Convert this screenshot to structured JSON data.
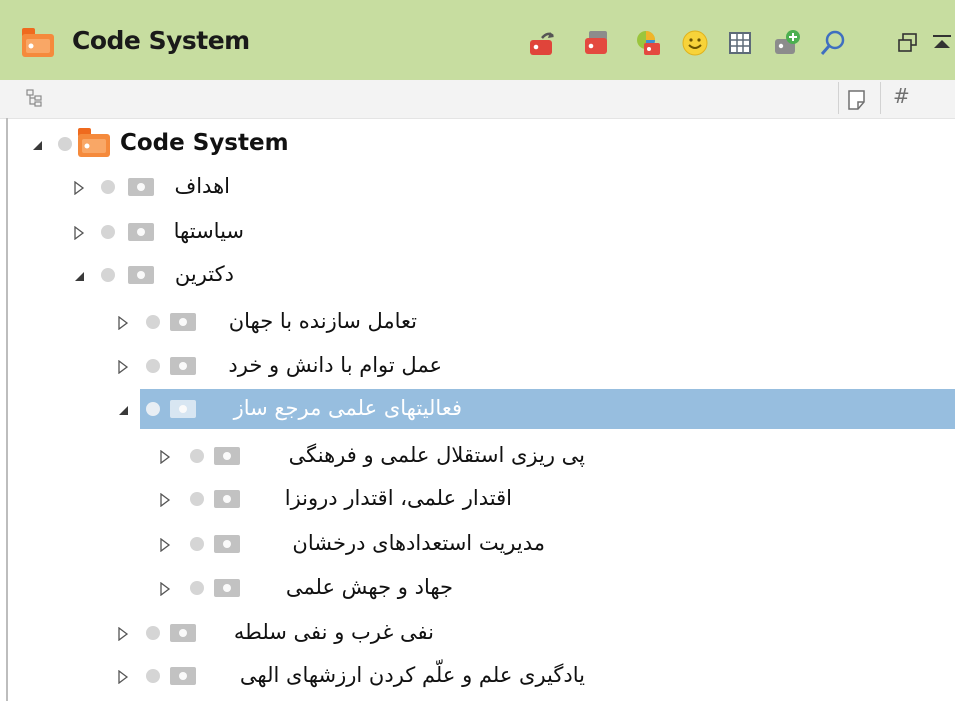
{
  "header": {
    "title": "Code System",
    "toolbar_icons": [
      "reset-activation-icon",
      "code-tags-icon",
      "code-colors-icon",
      "emoticon-icon",
      "matrix-table-icon",
      "new-code-icon",
      "search-icon",
      "undock-icon",
      "collapse-panel-icon"
    ]
  },
  "columns": {
    "memo_icon": "memo-icon",
    "count_label": "#"
  },
  "tree": {
    "root": {
      "label": "Code System"
    },
    "nodes": [
      {
        "label": "اهداف",
        "level": 1,
        "expanded": false
      },
      {
        "label": "سیاستها",
        "level": 1,
        "expanded": false
      },
      {
        "label": "دکترین",
        "level": 1,
        "expanded": true
      },
      {
        "label": "تعامل سازنده با جهان",
        "level": 2,
        "expanded": false
      },
      {
        "label": "عمل توام با دانش و خرد",
        "level": 2,
        "expanded": false
      },
      {
        "label": "فعالیتهای علمی مرجع ساز",
        "level": 2,
        "expanded": true,
        "selected": true
      },
      {
        "label": "پی ریزی استقلال علمی و فرهنگی",
        "level": 3,
        "expanded": false
      },
      {
        "label": "اقتدار علمی، اقتدار درونزا",
        "level": 3,
        "expanded": false
      },
      {
        "label": "مدیریت استعدادهای درخشان",
        "level": 3,
        "expanded": false
      },
      {
        "label": "جهاد و جهش علمی",
        "level": 3,
        "expanded": false
      },
      {
        "label": "نفی غرب و نفی سلطه",
        "level": 2,
        "expanded": false
      },
      {
        "label": "یادگیری علم و علّم کردن ارزشهای الهی",
        "level": 2,
        "expanded": false
      }
    ]
  },
  "colors": {
    "header_bg": "#c7dda0",
    "selection": "#97bedf",
    "code_system_orange": "#f47a2c"
  }
}
